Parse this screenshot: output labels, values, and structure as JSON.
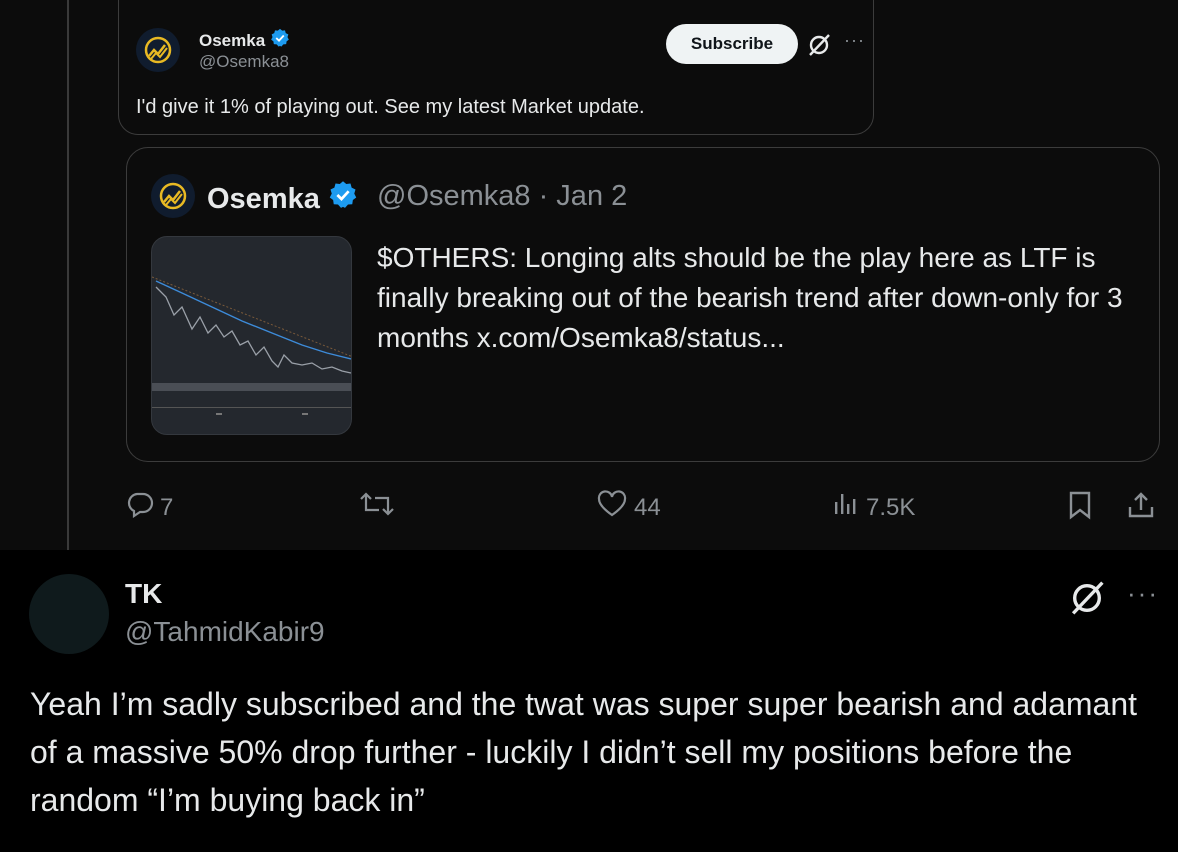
{
  "quoted_reply": {
    "author_name": "Osemka",
    "author_handle": "@Osemka8",
    "subscribe_label": "Subscribe",
    "more_label": "···",
    "text": "I'd give it 1% of playing out. See my latest Market update."
  },
  "quoted_tweet": {
    "author_name": "Osemka",
    "author_handle_date": "@Osemka8 · Jan 2",
    "text": "$OTHERS: Longing alts should be the play here as LTF is finally breaking out of the bearish trend after down-only for 3 months  x.com/Osemka8/status..."
  },
  "actions": {
    "replies": "7",
    "likes": "44",
    "views": "7.5K"
  },
  "reply": {
    "author_name": "TK",
    "author_handle": "@TahmidKabir9",
    "more_label": "···",
    "text": "Yeah I’m sadly subscribed and the twat was super super bearish and adamant of a massive 50% drop further - luckily I didn’t sell my positions before the random “I’m buying back in”"
  },
  "colors": {
    "background": "#0c0c0c",
    "reply_background": "#000000",
    "verified": "#1d9bf0",
    "logo_gold": "#e8b923",
    "muted_text": "#8b9095"
  },
  "icons": [
    "logo-icon",
    "verified-icon",
    "grok-icon",
    "reply-icon",
    "retweet-icon",
    "like-icon",
    "views-icon",
    "bookmark-icon",
    "share-icon"
  ]
}
